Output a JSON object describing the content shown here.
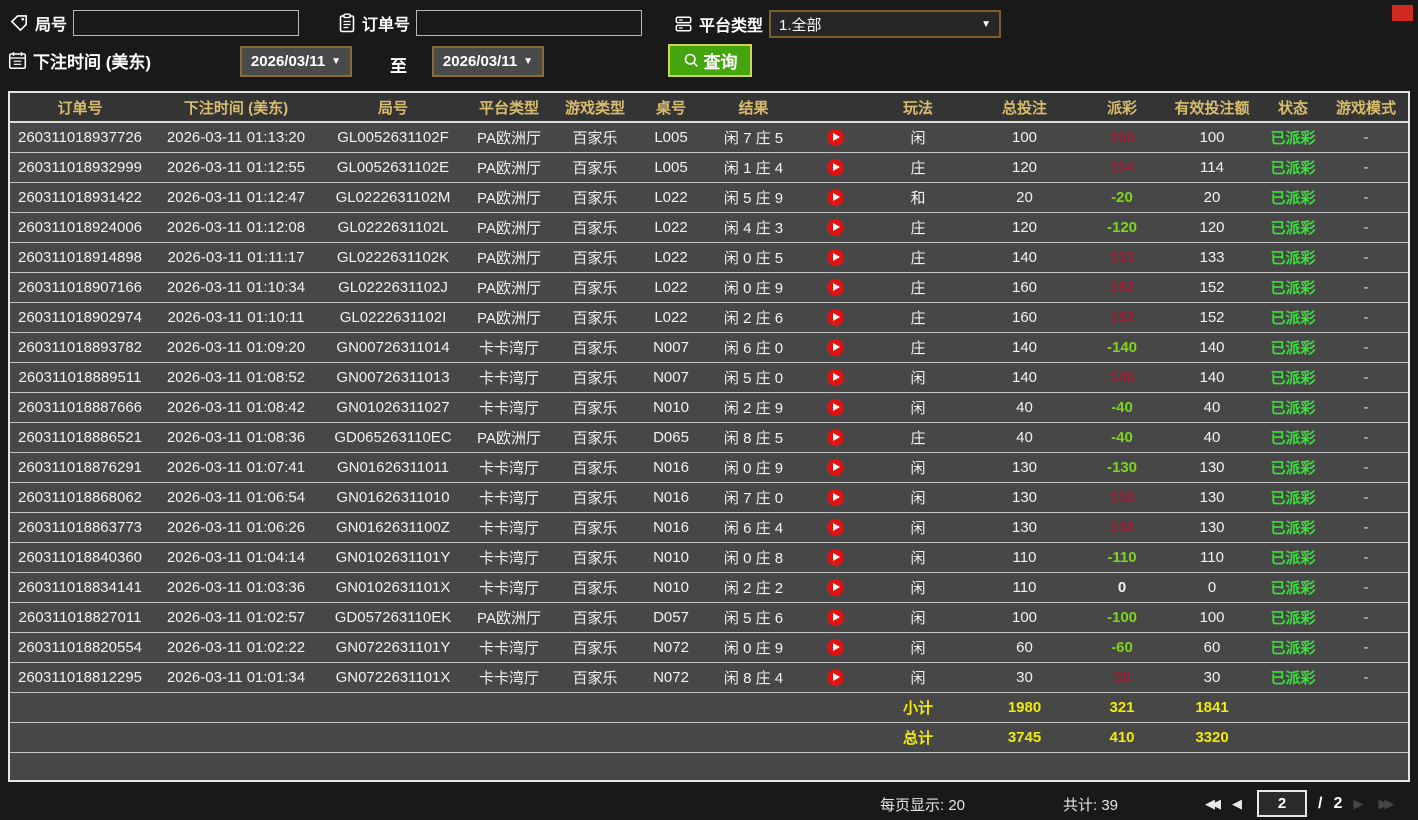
{
  "filters": {
    "round_label": "局号",
    "order_label": "订单号",
    "platform_label": "平台类型",
    "platform_value": "1.全部",
    "bet_time_label": "下注时间 (美东)",
    "date_from": "2026/03/11",
    "date_to": "2026/03/11",
    "to_label": "至",
    "search_label": "查询"
  },
  "colors": {
    "header_gold": "#d9bd6e",
    "payout_positive_red": "#9c1b30",
    "payout_negative_green": "#7ed321",
    "status_green": "#3ddd3d",
    "totals_yellow": "#f0eb0a",
    "search_button_green": "#45a50f",
    "play_icon_red": "#e01212"
  },
  "table": {
    "headers": [
      "订单号",
      "下注时间 (美东)",
      "局号",
      "平台类型",
      "游戏类型",
      "桌号",
      "结果",
      "",
      "玩法",
      "总投注",
      "派彩",
      "有效投注额",
      "状态",
      "游戏模式"
    ],
    "rows": [
      {
        "order": "260311018937726",
        "time": "2026-03-11 01:13:20",
        "round": "GL0052631102F",
        "platform": "PA欧洲厅",
        "game": "百家乐",
        "table": "L005",
        "result": "闲 7 庄 5",
        "bet": "闲",
        "total": "100",
        "payout": "100",
        "valid": "100",
        "status": "已派彩",
        "mode": "-"
      },
      {
        "order": "260311018932999",
        "time": "2026-03-11 01:12:55",
        "round": "GL0052631102E",
        "platform": "PA欧洲厅",
        "game": "百家乐",
        "table": "L005",
        "result": "闲 1 庄 4",
        "bet": "庄",
        "total": "120",
        "payout": "114",
        "valid": "114",
        "status": "已派彩",
        "mode": "-"
      },
      {
        "order": "260311018931422",
        "time": "2026-03-11 01:12:47",
        "round": "GL0222631102M",
        "platform": "PA欧洲厅",
        "game": "百家乐",
        "table": "L022",
        "result": "闲 5 庄 9",
        "bet": "和",
        "total": "20",
        "payout": "-20",
        "valid": "20",
        "status": "已派彩",
        "mode": "-"
      },
      {
        "order": "260311018924006",
        "time": "2026-03-11 01:12:08",
        "round": "GL0222631102L",
        "platform": "PA欧洲厅",
        "game": "百家乐",
        "table": "L022",
        "result": "闲 4 庄 3",
        "bet": "庄",
        "total": "120",
        "payout": "-120",
        "valid": "120",
        "status": "已派彩",
        "mode": "-"
      },
      {
        "order": "260311018914898",
        "time": "2026-03-11 01:11:17",
        "round": "GL0222631102K",
        "platform": "PA欧洲厅",
        "game": "百家乐",
        "table": "L022",
        "result": "闲 0 庄 5",
        "bet": "庄",
        "total": "140",
        "payout": "133",
        "valid": "133",
        "status": "已派彩",
        "mode": "-"
      },
      {
        "order": "260311018907166",
        "time": "2026-03-11 01:10:34",
        "round": "GL0222631102J",
        "platform": "PA欧洲厅",
        "game": "百家乐",
        "table": "L022",
        "result": "闲 0 庄 9",
        "bet": "庄",
        "total": "160",
        "payout": "152",
        "valid": "152",
        "status": "已派彩",
        "mode": "-"
      },
      {
        "order": "260311018902974",
        "time": "2026-03-11 01:10:11",
        "round": "GL0222631102I",
        "platform": "PA欧洲厅",
        "game": "百家乐",
        "table": "L022",
        "result": "闲 2 庄 6",
        "bet": "庄",
        "total": "160",
        "payout": "152",
        "valid": "152",
        "status": "已派彩",
        "mode": "-"
      },
      {
        "order": "260311018893782",
        "time": "2026-03-11 01:09:20",
        "round": "GN00726311014",
        "platform": "卡卡湾厅",
        "game": "百家乐",
        "table": "N007",
        "result": "闲 6 庄 0",
        "bet": "庄",
        "total": "140",
        "payout": "-140",
        "valid": "140",
        "status": "已派彩",
        "mode": "-"
      },
      {
        "order": "260311018889511",
        "time": "2026-03-11 01:08:52",
        "round": "GN00726311013",
        "platform": "卡卡湾厅",
        "game": "百家乐",
        "table": "N007",
        "result": "闲 5 庄 0",
        "bet": "闲",
        "total": "140",
        "payout": "140",
        "valid": "140",
        "status": "已派彩",
        "mode": "-"
      },
      {
        "order": "260311018887666",
        "time": "2026-03-11 01:08:42",
        "round": "GN01026311027",
        "platform": "卡卡湾厅",
        "game": "百家乐",
        "table": "N010",
        "result": "闲 2 庄 9",
        "bet": "闲",
        "total": "40",
        "payout": "-40",
        "valid": "40",
        "status": "已派彩",
        "mode": "-"
      },
      {
        "order": "260311018886521",
        "time": "2026-03-11 01:08:36",
        "round": "GD065263110EC",
        "platform": "PA欧洲厅",
        "game": "百家乐",
        "table": "D065",
        "result": "闲 8 庄 5",
        "bet": "庄",
        "total": "40",
        "payout": "-40",
        "valid": "40",
        "status": "已派彩",
        "mode": "-"
      },
      {
        "order": "260311018876291",
        "time": "2026-03-11 01:07:41",
        "round": "GN01626311011",
        "platform": "卡卡湾厅",
        "game": "百家乐",
        "table": "N016",
        "result": "闲 0 庄 9",
        "bet": "闲",
        "total": "130",
        "payout": "-130",
        "valid": "130",
        "status": "已派彩",
        "mode": "-"
      },
      {
        "order": "260311018868062",
        "time": "2026-03-11 01:06:54",
        "round": "GN01626311010",
        "platform": "卡卡湾厅",
        "game": "百家乐",
        "table": "N016",
        "result": "闲 7 庄 0",
        "bet": "闲",
        "total": "130",
        "payout": "130",
        "valid": "130",
        "status": "已派彩",
        "mode": "-"
      },
      {
        "order": "260311018863773",
        "time": "2026-03-11 01:06:26",
        "round": "GN0162631100Z",
        "platform": "卡卡湾厅",
        "game": "百家乐",
        "table": "N016",
        "result": "闲 6 庄 4",
        "bet": "闲",
        "total": "130",
        "payout": "130",
        "valid": "130",
        "status": "已派彩",
        "mode": "-"
      },
      {
        "order": "260311018840360",
        "time": "2026-03-11 01:04:14",
        "round": "GN0102631101Y",
        "platform": "卡卡湾厅",
        "game": "百家乐",
        "table": "N010",
        "result": "闲 0 庄 8",
        "bet": "闲",
        "total": "110",
        "payout": "-110",
        "valid": "110",
        "status": "已派彩",
        "mode": "-"
      },
      {
        "order": "260311018834141",
        "time": "2026-03-11 01:03:36",
        "round": "GN0102631101X",
        "platform": "卡卡湾厅",
        "game": "百家乐",
        "table": "N010",
        "result": "闲 2 庄 2",
        "bet": "闲",
        "total": "110",
        "payout": "0",
        "valid": "0",
        "status": "已派彩",
        "mode": "-"
      },
      {
        "order": "260311018827011",
        "time": "2026-03-11 01:02:57",
        "round": "GD057263110EK",
        "platform": "PA欧洲厅",
        "game": "百家乐",
        "table": "D057",
        "result": "闲 5 庄 6",
        "bet": "闲",
        "total": "100",
        "payout": "-100",
        "valid": "100",
        "status": "已派彩",
        "mode": "-"
      },
      {
        "order": "260311018820554",
        "time": "2026-03-11 01:02:22",
        "round": "GN0722631101Y",
        "platform": "卡卡湾厅",
        "game": "百家乐",
        "table": "N072",
        "result": "闲 0 庄 9",
        "bet": "闲",
        "total": "60",
        "payout": "-60",
        "valid": "60",
        "status": "已派彩",
        "mode": "-"
      },
      {
        "order": "260311018812295",
        "time": "2026-03-11 01:01:34",
        "round": "GN0722631101X",
        "platform": "卡卡湾厅",
        "game": "百家乐",
        "table": "N072",
        "result": "闲 8 庄 4",
        "bet": "闲",
        "total": "30",
        "payout": "30",
        "valid": "30",
        "status": "已派彩",
        "mode": "-"
      }
    ],
    "subtotal": {
      "label": "小计",
      "total": "1980",
      "payout": "321",
      "valid": "1841"
    },
    "grand_total": {
      "label": "总计",
      "total": "3745",
      "payout": "410",
      "valid": "3320"
    }
  },
  "pagination": {
    "per_page_label": "每页显示: 20",
    "total_label": "共计: 39",
    "current_page": "2",
    "separator": "/",
    "total_pages": "2"
  }
}
